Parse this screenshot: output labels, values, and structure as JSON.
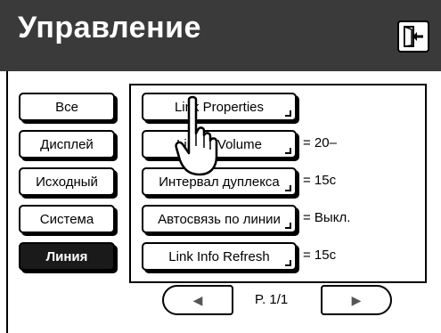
{
  "header": {
    "title": "Управление",
    "exit_icon": "exit-door-icon"
  },
  "categories": [
    {
      "label": "Все",
      "active": false
    },
    {
      "label": "Дисплей",
      "active": false
    },
    {
      "label": "Исходный",
      "active": false
    },
    {
      "label": "Система",
      "active": false
    },
    {
      "label": "Линия",
      "active": true
    }
  ],
  "items": [
    {
      "label": "Link Properties",
      "value": ""
    },
    {
      "label": "Link-fr  Volume",
      "value": "= 20–"
    },
    {
      "label": "Интервал дуплекса",
      "value": "= 15c"
    },
    {
      "label": "Автосвязь по линии",
      "value": "= Выкл."
    },
    {
      "label": "Link Info Refresh",
      "value": "= 15c"
    }
  ],
  "pager": {
    "prev_icon": "◀",
    "next_icon": "▶",
    "page_text": "P. 1/1"
  },
  "colors": {
    "header_bg": "#3a3a3a",
    "active_bg": "#1a1a1a"
  }
}
